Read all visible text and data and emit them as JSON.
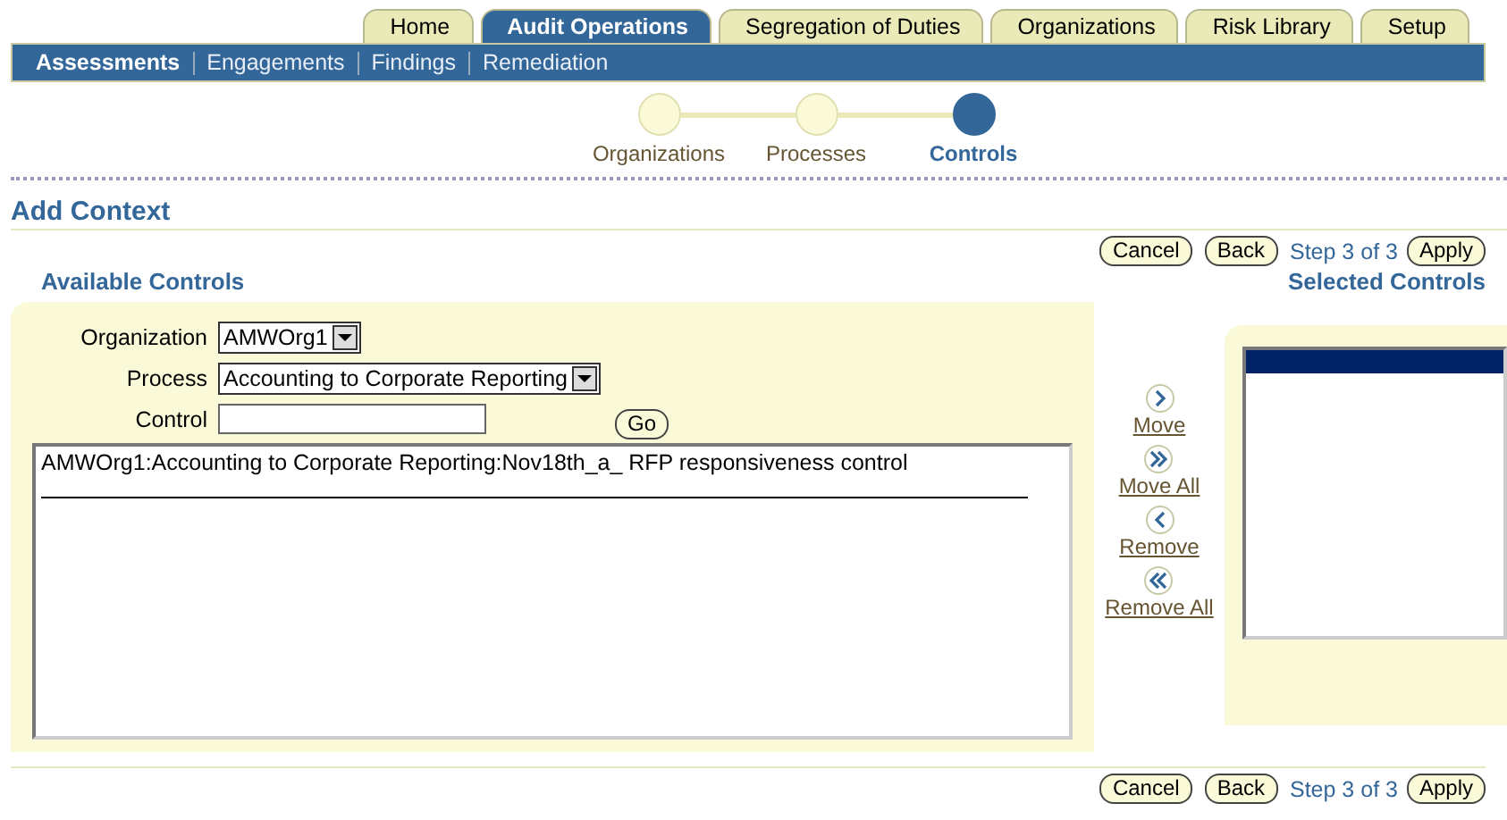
{
  "tabs": [
    {
      "label": "Home",
      "selected": false
    },
    {
      "label": "Audit Operations",
      "selected": true
    },
    {
      "label": "Segregation of Duties",
      "selected": false
    },
    {
      "label": "Organizations",
      "selected": false
    },
    {
      "label": "Risk Library",
      "selected": false
    },
    {
      "label": "Setup",
      "selected": false
    }
  ],
  "subtabs": [
    {
      "label": "Assessments",
      "selected": true
    },
    {
      "label": "Engagements",
      "selected": false
    },
    {
      "label": "Findings",
      "selected": false
    },
    {
      "label": "Remediation",
      "selected": false
    }
  ],
  "train": [
    {
      "label": "Organizations",
      "selected": false
    },
    {
      "label": "Processes",
      "selected": false
    },
    {
      "label": "Controls",
      "selected": true
    }
  ],
  "page_title": "Add Context",
  "top_actions": {
    "cancel": "Cancel",
    "back": "Back",
    "step": "Step 3 of 3",
    "apply": "Apply"
  },
  "available": {
    "title": "Available Controls",
    "organization": {
      "label": "Organization",
      "value": "AMWOrg1"
    },
    "process": {
      "label": "Process",
      "value": "Accounting to Corporate Reporting"
    },
    "control": {
      "label": "Control"
    },
    "go": "Go",
    "items": [
      "AMWOrg1:Accounting to Corporate Reporting:Nov18th_a_ RFP responsiveness control"
    ]
  },
  "shuttle": [
    "Move",
    "Move All",
    "Remove",
    "Remove All"
  ],
  "selected_controls": {
    "title": "Selected Controls"
  },
  "bottom_actions": {
    "cancel": "Cancel",
    "back": "Back",
    "step": "Step 3 of 3",
    "apply": "Apply"
  }
}
